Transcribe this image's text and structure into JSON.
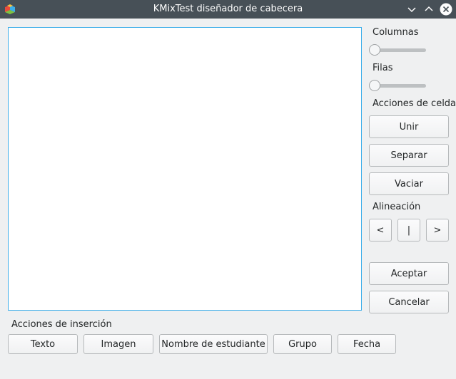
{
  "window": {
    "title": "KMixTest diseñador de cabecera"
  },
  "right_panel": {
    "columns_label": "Columnas",
    "columns_value": 0,
    "rows_label": "Filas",
    "rows_value": 0,
    "cell_actions_label": "Acciones de celda",
    "merge_label": "Unir",
    "split_label": "Separar",
    "clear_label": "Vaciar",
    "alignment_label": "Alineación",
    "align_left_label": "<",
    "align_center_label": "|",
    "align_right_label": ">",
    "accept_label": "Aceptar",
    "cancel_label": "Cancelar"
  },
  "insert_actions": {
    "label": "Acciones de inserción",
    "text_label": "Texto",
    "image_label": "Imagen",
    "student_name_label": "Nombre de estudiante",
    "group_label": "Grupo",
    "date_label": "Fecha"
  },
  "colors": {
    "titlebar": "#475057",
    "focus_border": "#3daee9",
    "background": "#eff0f1"
  }
}
